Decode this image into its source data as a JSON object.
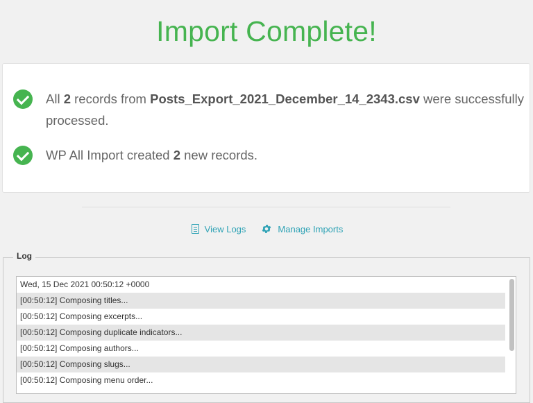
{
  "title": "Import Complete!",
  "messages": {
    "first": {
      "prefix": "All ",
      "count": "2",
      "middle": " records from ",
      "filename": "Posts_Export_2021_December_14_2343.csv",
      "suffix": " were successfully processed."
    },
    "second": {
      "prefix": "WP All Import created ",
      "count": "2",
      "suffix": " new records."
    }
  },
  "links": {
    "view_logs": "View Logs",
    "manage_imports": "Manage Imports"
  },
  "log": {
    "legend": "Log",
    "lines": [
      "Wed, 15 Dec 2021 00:50:12 +0000",
      "[00:50:12] Composing titles...",
      "[00:50:12] Composing excerpts...",
      "[00:50:12] Composing duplicate indicators...",
      "[00:50:12] Composing authors...",
      "[00:50:12] Composing slugs...",
      "[00:50:12] Composing menu order..."
    ]
  },
  "colors": {
    "success": "#46b450",
    "link": "#2ea2b5"
  },
  "icons": {
    "check": "check-circle-icon",
    "logs": "document-icon",
    "manage": "gear-icon"
  }
}
